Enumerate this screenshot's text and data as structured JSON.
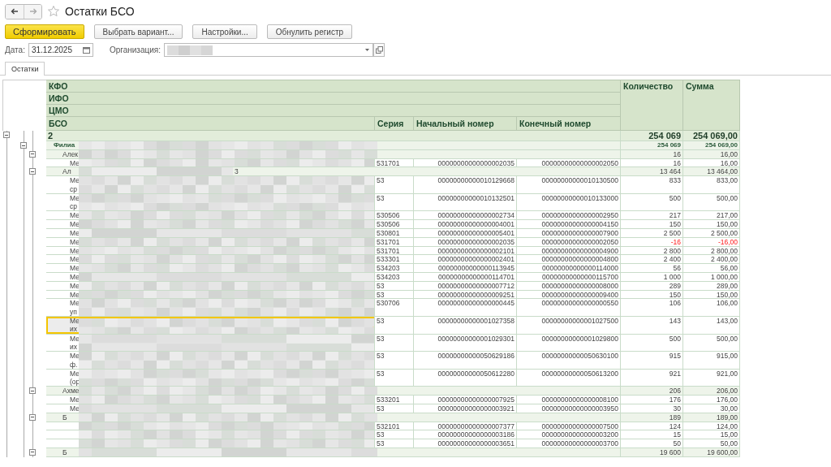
{
  "window": {
    "title": "Остатки БСО"
  },
  "buttons": [
    {
      "label": "Сформировать",
      "kind": "primary"
    },
    {
      "label": "Выбрать вариант...",
      "kind": "normal"
    },
    {
      "label": "Настройки...",
      "kind": "normal"
    },
    {
      "label": "Обнулить регистр",
      "kind": "normal"
    }
  ],
  "date": {
    "label": "Дата:",
    "value": "31.12.2025"
  },
  "organization": {
    "label": "Организация:"
  },
  "tabs": [
    {
      "label": "Остатки",
      "selected": true
    }
  ],
  "table": {
    "header_rows": [
      "КФО",
      "ИФО",
      "ЦМО"
    ],
    "columns": [
      "БСО",
      "Серия",
      "Начальный номер",
      "Конечный номер"
    ],
    "total_columns": [
      "Количество",
      "Сумма"
    ],
    "rows": [
      {
        "kind": "group",
        "name": "2",
        "expanded": true,
        "quantity": "254 069",
        "sum": "254 069,00",
        "children": [
          {
            "kind": "group",
            "name": "Филиа",
            "expanded": true,
            "quantity": "254 069",
            "sum": "254 069,00",
            "children": [
              {
                "kind": "group",
                "name": "Алек",
                "expanded": true,
                "quantity": "16",
                "sum": "16,00",
                "children": [
                  {
                    "kind": "item",
                    "name": "Ме",
                    "series": "531701",
                    "start": "00000000000000002035",
                    "end": "00000000000000002050",
                    "quantity": "16",
                    "sum": "16,00",
                    "negative": false,
                    "selected": false
                  }
                ]
              },
              {
                "kind": "group",
                "name": "Ал",
                "tail": "3",
                "expanded": true,
                "quantity": "13 464",
                "sum": "13 464,00",
                "children": [
                  {
                    "kind": "item",
                    "name": "Ме\nср",
                    "series": "53",
                    "start": "00000000000010129668",
                    "end": "00000000000010130500",
                    "quantity": "833",
                    "sum": "833,00",
                    "negative": false,
                    "selected": false
                  },
                  {
                    "kind": "item",
                    "name": "Ме\nср",
                    "series": "53",
                    "start": "00000000000010132501",
                    "end": "00000000000010133000",
                    "quantity": "500",
                    "sum": "500,00",
                    "negative": false,
                    "selected": false
                  },
                  {
                    "kind": "item",
                    "name": "Ме",
                    "series": "530506",
                    "start": "00000000000000002734",
                    "end": "00000000000000002950",
                    "quantity": "217",
                    "sum": "217,00",
                    "negative": false,
                    "selected": false
                  },
                  {
                    "kind": "item",
                    "name": "Ме",
                    "series": "530506",
                    "start": "00000000000000004001",
                    "end": "00000000000000004150",
                    "quantity": "150",
                    "sum": "150,00",
                    "negative": false,
                    "selected": false
                  },
                  {
                    "kind": "item",
                    "name": "Ме",
                    "series": "530801",
                    "start": "00000000000000005401",
                    "end": "00000000000000007900",
                    "quantity": "2 500",
                    "sum": "2 500,00",
                    "negative": false,
                    "selected": false
                  },
                  {
                    "kind": "item",
                    "name": "Ме",
                    "series": "531701",
                    "start": "00000000000000002035",
                    "end": "00000000000000002050",
                    "quantity": "-16",
                    "sum": "-16,00",
                    "negative": true,
                    "selected": false
                  },
                  {
                    "kind": "item",
                    "name": "Ме",
                    "series": "531701",
                    "start": "00000000000000002101",
                    "end": "00000000000000004900",
                    "quantity": "2 800",
                    "sum": "2 800,00",
                    "negative": false,
                    "selected": false
                  },
                  {
                    "kind": "item",
                    "name": "Ме",
                    "series": "533301",
                    "start": "00000000000000002401",
                    "end": "00000000000000004800",
                    "quantity": "2 400",
                    "sum": "2 400,00",
                    "negative": false,
                    "selected": false
                  },
                  {
                    "kind": "item",
                    "name": "Ме",
                    "series": "534203",
                    "start": "00000000000000113945",
                    "end": "00000000000000114000",
                    "quantity": "56",
                    "sum": "56,00",
                    "negative": false,
                    "selected": false
                  },
                  {
                    "kind": "item",
                    "name": "Ме",
                    "series": "534203",
                    "start": "00000000000000114701",
                    "end": "00000000000000115700",
                    "quantity": "1 000",
                    "sum": "1 000,00",
                    "negative": false,
                    "selected": false
                  },
                  {
                    "kind": "item",
                    "name": "Ме",
                    "series": "53",
                    "start": "00000000000000007712",
                    "end": "00000000000000008000",
                    "quantity": "289",
                    "sum": "289,00",
                    "negative": false,
                    "selected": false
                  },
                  {
                    "kind": "item",
                    "name": "Ме",
                    "series": "53",
                    "start": "00000000000000009251",
                    "end": "00000000000000009400",
                    "quantity": "150",
                    "sum": "150,00",
                    "negative": false,
                    "selected": false
                  },
                  {
                    "kind": "item",
                    "name": "Ме\nуп",
                    "series": "530706",
                    "start": "00000000000000000445",
                    "end": "00000000000000000550",
                    "quantity": "106",
                    "sum": "106,00",
                    "negative": false,
                    "selected": false
                  },
                  {
                    "kind": "item",
                    "name": "Ме\nих",
                    "series": "53",
                    "start": "00000000000001027358",
                    "end": "00000000000001027500",
                    "quantity": "143",
                    "sum": "143,00",
                    "negative": false,
                    "selected": true
                  },
                  {
                    "kind": "item",
                    "name": "Ме\nих",
                    "series": "53",
                    "start": "00000000000001029301",
                    "end": "00000000000001029800",
                    "quantity": "500",
                    "sum": "500,00",
                    "negative": false,
                    "selected": false
                  },
                  {
                    "kind": "item",
                    "name": "Ме\nф.",
                    "series": "53",
                    "start": "00000000000050629186",
                    "end": "00000000000050630100",
                    "quantity": "915",
                    "sum": "915,00",
                    "negative": false,
                    "selected": false
                  },
                  {
                    "kind": "item",
                    "name": "Ме\n(ор",
                    "series": "53",
                    "start": "00000000000050612280",
                    "end": "00000000000050613200",
                    "quantity": "921",
                    "sum": "921,00",
                    "negative": false,
                    "selected": false
                  }
                ]
              },
              {
                "kind": "group",
                "name": "Ахме",
                "expanded": true,
                "quantity": "206",
                "sum": "206,00",
                "children": [
                  {
                    "kind": "item",
                    "name": "Ме",
                    "series": "533201",
                    "start": "00000000000000007925",
                    "end": "00000000000000008100",
                    "quantity": "176",
                    "sum": "176,00",
                    "negative": false,
                    "selected": false
                  },
                  {
                    "kind": "item",
                    "name": "Ме",
                    "series": "53",
                    "start": "00000000000000003921",
                    "end": "00000000000000003950",
                    "quantity": "30",
                    "sum": "30,00",
                    "negative": false,
                    "selected": false
                  }
                ]
              },
              {
                "kind": "group",
                "name": "Б",
                "expanded": true,
                "quantity": "189",
                "sum": "189,00",
                "children": [
                  {
                    "kind": "item",
                    "series": "532101",
                    "start": "00000000000000007377",
                    "end": "00000000000000007500",
                    "quantity": "124",
                    "sum": "124,00",
                    "negative": false,
                    "selected": false
                  },
                  {
                    "kind": "item",
                    "series": "53",
                    "start": "00000000000000003186",
                    "end": "00000000000000003200",
                    "quantity": "15",
                    "sum": "15,00",
                    "negative": false,
                    "selected": false
                  },
                  {
                    "kind": "item",
                    "series": "53",
                    "start": "00000000000000003651",
                    "end": "00000000000000003700",
                    "quantity": "50",
                    "sum": "50,00",
                    "negative": false,
                    "selected": false
                  }
                ]
              },
              {
                "kind": "group",
                "name": "Б",
                "expanded": true,
                "quantity": "19 600",
                "sum": "19 600,00"
              }
            ]
          }
        ]
      }
    ]
  }
}
